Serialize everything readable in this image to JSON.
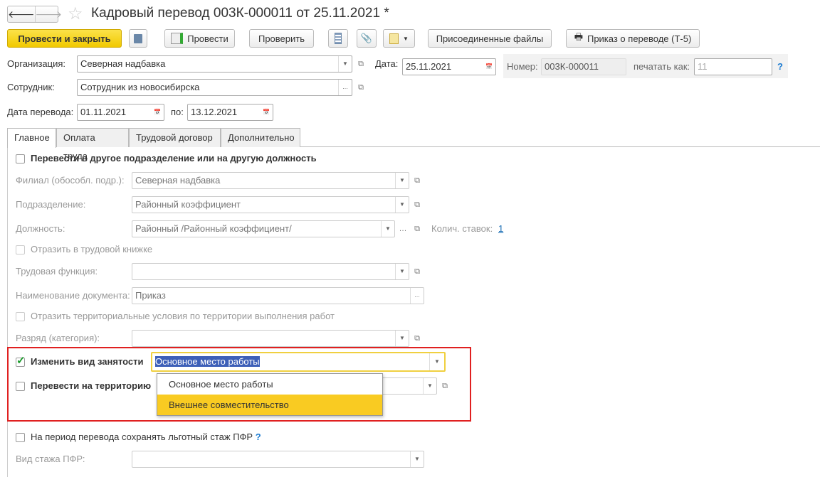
{
  "window": {
    "title": "Кадровый перевод 003К-000011 от 25.11.2021 *"
  },
  "toolbar": {
    "post_close": "Провести и закрыть",
    "post": "Провести",
    "check": "Проверить",
    "attached": "Присоединенные файлы",
    "order": "Приказ о переводе (Т-5)"
  },
  "header": {
    "org_label": "Организация:",
    "org_value": "Северная надбавка",
    "date_label": "Дата:",
    "date_value": "25.11.2021",
    "number_label": "Номер:",
    "number_value": "003К-000011",
    "print_label": "печатать как:",
    "print_value": "11",
    "help": "?",
    "employee_label": "Сотрудник:",
    "employee_value": "Сотрудник из новосибирска",
    "transfer_date_label": "Дата перевода:",
    "transfer_date_value": "01.11.2021",
    "to_label": "по:",
    "to_value": "13.12.2021"
  },
  "tabs": [
    "Главное",
    "Оплата труда",
    "Трудовой договор",
    "Дополнительно"
  ],
  "main": {
    "transfer_chk": "Перевести в другое подразделение или на другую должность",
    "branch_label": "Филиал (обособл. подр.):",
    "branch_value": "Северная надбавка",
    "dept_label": "Подразделение:",
    "dept_value": "Районный коэффициент",
    "position_label": "Должность:",
    "position_value": "Районный /Районный коэффициент/",
    "rates_label": "Колич. ставок:",
    "rates_value": "1",
    "workbook_chk": "Отразить в трудовой книжке",
    "labor_func_label": "Трудовая функция:",
    "labor_func_value": "",
    "doc_name_label": "Наименование документа:",
    "doc_name_value": "Приказ",
    "territorial_chk": "Отразить территориальные условия по территории выполнения работ",
    "grade_label": "Разряд (категория):",
    "employment_chk": "Изменить вид занятости",
    "employment_value": "Основное место работы",
    "territory_chk": "Перевести на территорию",
    "options": [
      "Основное место работы",
      "Внешнее совместительство"
    ],
    "pfr_chk": "На период перевода сохранять льготный стаж ПФР",
    "pfr_help": "?",
    "pfr_type_label": "Вид стажа ПФР:"
  },
  "colors": {
    "accent": "#f5d41f",
    "highlight": "#f9cb22",
    "red_frame": "#e02020"
  }
}
